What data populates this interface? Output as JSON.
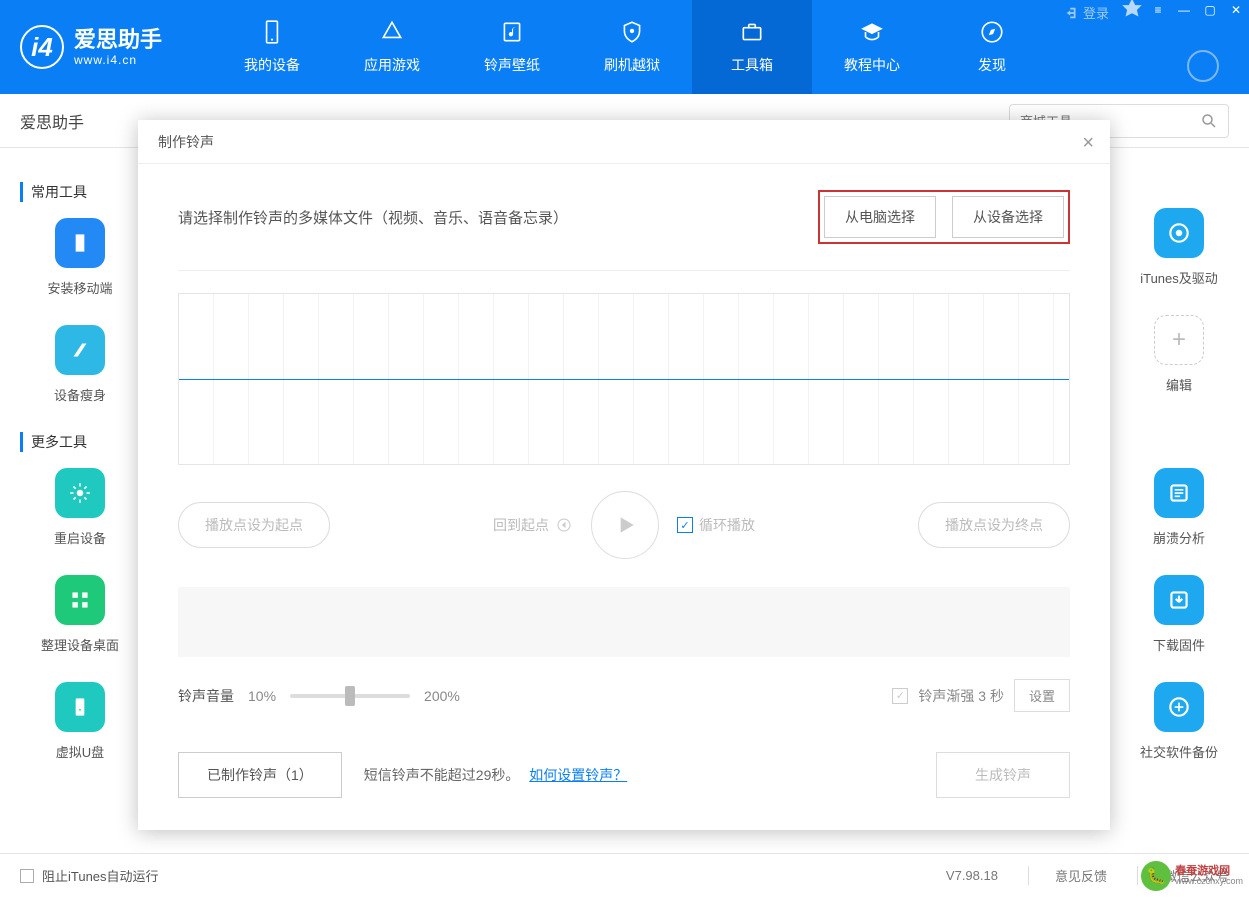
{
  "titlebar": {
    "login": "登录"
  },
  "logo": {
    "cn": "爱思助手",
    "en": "www.i4.cn"
  },
  "nav": [
    {
      "label": "我的设备"
    },
    {
      "label": "应用游戏"
    },
    {
      "label": "铃声壁纸"
    },
    {
      "label": "刷机越狱"
    },
    {
      "label": "工具箱",
      "active": true
    },
    {
      "label": "教程中心"
    },
    {
      "label": "发现"
    }
  ],
  "subheader": {
    "title": "爱思助手",
    "search_placeholder": "商城工具"
  },
  "sections": {
    "common": "常用工具",
    "more": "更多工具"
  },
  "side_tools": {
    "install_mobile": "安装移动端",
    "device_slim": "设备瘦身",
    "restart_device": "重启设备",
    "arrange_desktop": "整理设备桌面",
    "virtual_udisk": "虚拟U盘",
    "itunes_driver": "iTunes及驱动",
    "edit": "编辑",
    "crash_analysis": "崩溃分析",
    "download_firmware": "下载固件",
    "social_backup": "社交软件备份"
  },
  "modal": {
    "title": "制作铃声",
    "select_prompt": "请选择制作铃声的多媒体文件（视频、音乐、语音备忘录）",
    "from_computer": "从电脑选择",
    "from_device": "从设备选择",
    "set_start": "播放点设为起点",
    "back_to_start": "回到起点",
    "loop_play": "循环播放",
    "set_end": "播放点设为终点",
    "volume_label": "铃声音量",
    "vol_min": "10%",
    "vol_max": "200%",
    "fade_in": "铃声渐强 3 秒",
    "settings_btn": "设置",
    "made_ringtones": "已制作铃声（1）",
    "sms_note": "短信铃声不能超过29秒。",
    "how_to_link": "如何设置铃声？",
    "generate": "生成铃声"
  },
  "footer": {
    "block_itunes": "阻止iTunes自动运行",
    "version": "V7.98.18",
    "feedback": "意见反馈",
    "wechat": "微信公众号"
  },
  "watermark": {
    "line1": "春蚕游戏网",
    "line2": "www.czchxy.com"
  }
}
